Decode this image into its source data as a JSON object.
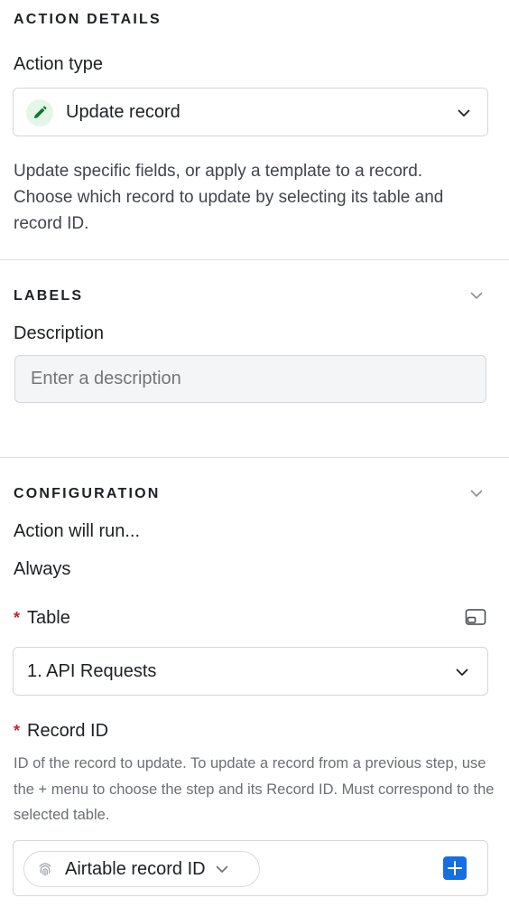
{
  "action_details": {
    "heading": "ACTION DETAILS",
    "action_type_label": "Action type",
    "action_type_value": "Update record",
    "action_type_icon": "pencil-icon",
    "description": "Update specific fields, or apply a template to a record. Choose which record to update by selecting its table and record ID."
  },
  "labels": {
    "heading": "LABELS",
    "description_label": "Description",
    "description_placeholder": "Enter a description"
  },
  "configuration": {
    "heading": "CONFIGURATION",
    "run_label": "Action will run...",
    "run_value": "Always",
    "table_label": "Table",
    "table_required_marker": "*",
    "table_value": "1. API Requests",
    "record_id_label": "Record ID",
    "record_id_required_marker": "*",
    "record_id_help": "ID of the record to update. To update a record from a previous step, use the + menu to choose the step and its Record ID. Must correspond to the selected table.",
    "record_id_pill": "Airtable record ID"
  },
  "colors": {
    "accent_blue": "#166ee1",
    "required_red": "#c3272f",
    "pencil_bg": "#e3f6e8",
    "pencil_green": "#0b7a2b"
  }
}
